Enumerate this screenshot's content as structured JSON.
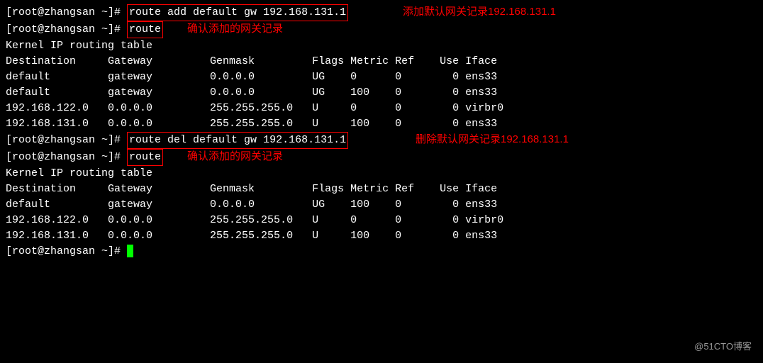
{
  "prompt": "[root@zhangsan ~]#",
  "cmd1": "route add default gw 192.168.131.1",
  "cmd2": "route",
  "cmd3": "route del default gw 192.168.131.1",
  "cmd4": "route",
  "ann1": "添加默认网关记录192.168.131.1",
  "ann2": "确认添加的网关记录",
  "ann3": "删除默认网关记录192.168.131.1",
  "ann4": "确认添加的网关记录",
  "table_title": "Kernel IP routing table",
  "header": {
    "dest": "Destination",
    "gw": "Gateway",
    "mask": "Genmask",
    "flags": "Flags",
    "metric": "Metric",
    "ref": "Ref",
    "use": "Use",
    "iface": "Iface"
  },
  "rows1": [
    {
      "dest": "default",
      "gw": "gateway",
      "mask": "0.0.0.0",
      "flags": "UG",
      "metric": "0",
      "ref": "0",
      "use": "0",
      "iface": "ens33"
    },
    {
      "dest": "default",
      "gw": "gateway",
      "mask": "0.0.0.0",
      "flags": "UG",
      "metric": "100",
      "ref": "0",
      "use": "0",
      "iface": "ens33"
    },
    {
      "dest": "192.168.122.0",
      "gw": "0.0.0.0",
      "mask": "255.255.255.0",
      "flags": "U",
      "metric": "0",
      "ref": "0",
      "use": "0",
      "iface": "virbr0"
    },
    {
      "dest": "192.168.131.0",
      "gw": "0.0.0.0",
      "mask": "255.255.255.0",
      "flags": "U",
      "metric": "100",
      "ref": "0",
      "use": "0",
      "iface": "ens33"
    }
  ],
  "rows2": [
    {
      "dest": "default",
      "gw": "gateway",
      "mask": "0.0.0.0",
      "flags": "UG",
      "metric": "100",
      "ref": "0",
      "use": "0",
      "iface": "ens33"
    },
    {
      "dest": "192.168.122.0",
      "gw": "0.0.0.0",
      "mask": "255.255.255.0",
      "flags": "U",
      "metric": "0",
      "ref": "0",
      "use": "0",
      "iface": "virbr0"
    },
    {
      "dest": "192.168.131.0",
      "gw": "0.0.0.0",
      "mask": "255.255.255.0",
      "flags": "U",
      "metric": "100",
      "ref": "0",
      "use": "0",
      "iface": "ens33"
    }
  ],
  "watermark": "@51CTO博客",
  "chart_data": {
    "type": "table",
    "title": "Kernel IP routing table (before and after delete)",
    "columns": [
      "Destination",
      "Gateway",
      "Genmask",
      "Flags",
      "Metric",
      "Ref",
      "Use",
      "Iface"
    ],
    "before": [
      [
        "default",
        "gateway",
        "0.0.0.0",
        "UG",
        0,
        0,
        0,
        "ens33"
      ],
      [
        "default",
        "gateway",
        "0.0.0.0",
        "UG",
        100,
        0,
        0,
        "ens33"
      ],
      [
        "192.168.122.0",
        "0.0.0.0",
        "255.255.255.0",
        "U",
        0,
        0,
        0,
        "virbr0"
      ],
      [
        "192.168.131.0",
        "0.0.0.0",
        "255.255.255.0",
        "U",
        100,
        0,
        0,
        "ens33"
      ]
    ],
    "after": [
      [
        "default",
        "gateway",
        "0.0.0.0",
        "UG",
        100,
        0,
        0,
        "ens33"
      ],
      [
        "192.168.122.0",
        "0.0.0.0",
        "255.255.255.0",
        "U",
        0,
        0,
        0,
        "virbr0"
      ],
      [
        "192.168.131.0",
        "0.0.0.0",
        "255.255.255.0",
        "U",
        100,
        0,
        0,
        "ens33"
      ]
    ]
  }
}
